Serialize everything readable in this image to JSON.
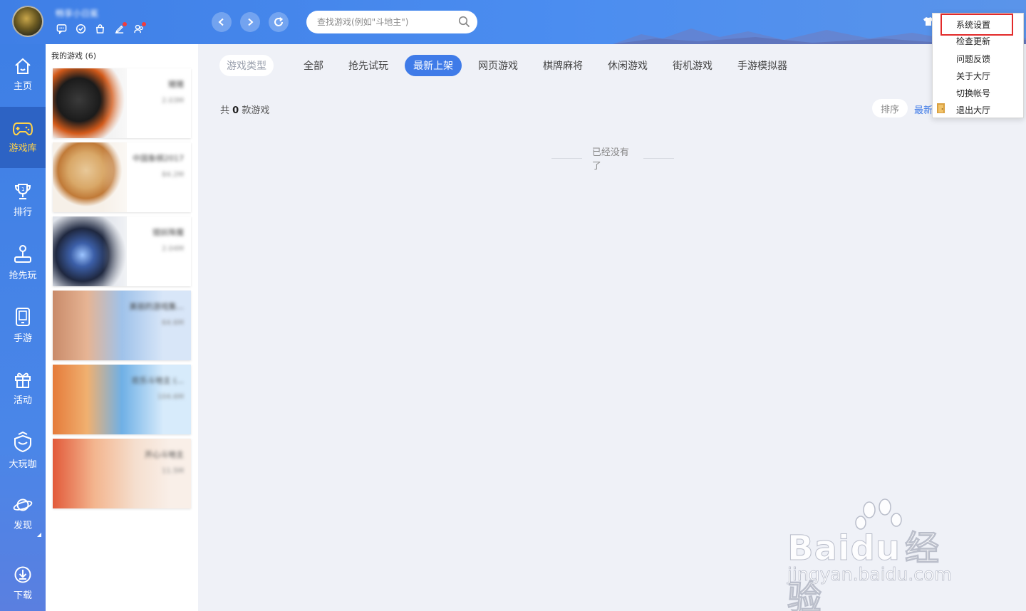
{
  "header": {
    "username": "畅享小日冕",
    "search": {
      "placeholder": "查找游戏(例如\"斗地主\")"
    },
    "icons": [
      "message-icon",
      "checkin-icon",
      "bag-icon",
      "edit-icon",
      "friends-icon"
    ]
  },
  "sidebar": {
    "items": [
      {
        "label": "主页",
        "icon": "home-icon",
        "active": false
      },
      {
        "label": "游戏库",
        "icon": "gamepad-icon",
        "active": true
      },
      {
        "label": "排行",
        "icon": "trophy-icon",
        "active": false
      },
      {
        "label": "抢先玩",
        "icon": "joystick-icon",
        "active": false
      },
      {
        "label": "手游",
        "icon": "phone-icon",
        "active": false
      },
      {
        "label": "活动",
        "icon": "gift-icon",
        "active": false
      },
      {
        "label": "大玩咖",
        "icon": "vip-icon",
        "active": false
      },
      {
        "label": "发现",
        "icon": "planet-icon",
        "active": false
      },
      {
        "label": "下载",
        "icon": "download-icon",
        "active": false
      }
    ]
  },
  "my_games": {
    "title": "我的游戏 (6)",
    "games": [
      {
        "name": "猪猪",
        "size": "2.03M"
      },
      {
        "name": "中国象棋2017",
        "size": "84.2M"
      },
      {
        "name": "猎妖降魔",
        "size": "2.04M"
      },
      {
        "name": "美丽的游戏集...",
        "size": "64.6M"
      },
      {
        "name": "欢乐斗地主 (...",
        "size": "104.6M"
      },
      {
        "name": "开心斗地主",
        "size": "11.5M"
      }
    ]
  },
  "filters": {
    "type_label": "游戏类型",
    "tabs": [
      "全部",
      "抢先试玩",
      "最新上架",
      "网页游戏",
      "棋牌麻将",
      "休闲游戏",
      "街机游戏",
      "手游模拟器"
    ],
    "active_tab": "最新上架"
  },
  "results": {
    "prefix": "共",
    "count": "0",
    "suffix": "款游戏",
    "sort_label": "排序",
    "sort_value": "最新",
    "empty_text": "已经没有了"
  },
  "menu": {
    "items": [
      "系统设置",
      "检查更新",
      "问题反馈",
      "关于大厅",
      "切换帐号",
      "退出大厅"
    ],
    "highlighted": "系统设置"
  },
  "watermark": {
    "brand": "Bai",
    "brand2": "du",
    "brand_cn": "经验",
    "url": "jingyan.baidu.com"
  },
  "colors": {
    "accent": "#3f7be8",
    "sidebar_active": "#2d63c4",
    "sidebar_active_text": "#ffd34a",
    "highlight_box": "#e22a2a"
  }
}
